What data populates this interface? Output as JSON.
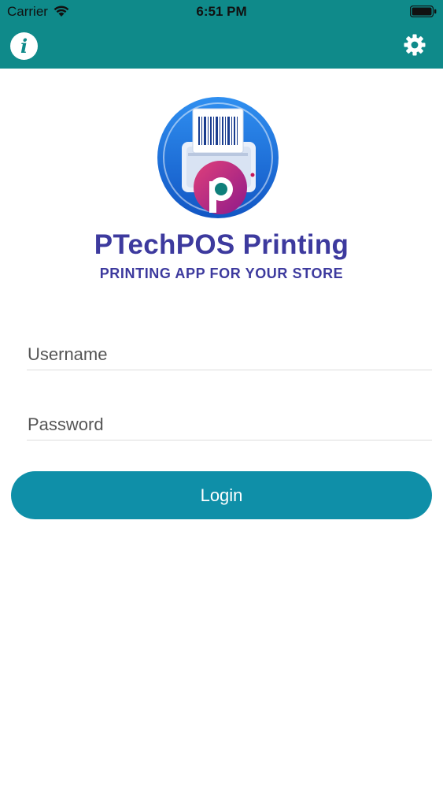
{
  "status_bar": {
    "carrier": "Carrier",
    "time": "6:51 PM",
    "wifi_icon": "wifi-icon",
    "battery_icon": "battery-icon"
  },
  "nav_bar": {
    "info_icon": "info-icon",
    "info_glyph": "i",
    "settings_icon": "gear-icon"
  },
  "brand": {
    "logo_icon": "printer-logo-icon",
    "title": "PTechPOS Printing",
    "subtitle": "PRINTING APP FOR YOUR STORE"
  },
  "login_form": {
    "username_placeholder": "Username",
    "username_value": "",
    "password_placeholder": "Password",
    "password_value": "",
    "login_label": "Login"
  },
  "colors": {
    "header": "#0f8a8a",
    "button": "#0f8fa8",
    "brand_text": "#3d3a9e",
    "logo_blue": "#1d6fd8",
    "logo_magenta": "#c2185b"
  }
}
